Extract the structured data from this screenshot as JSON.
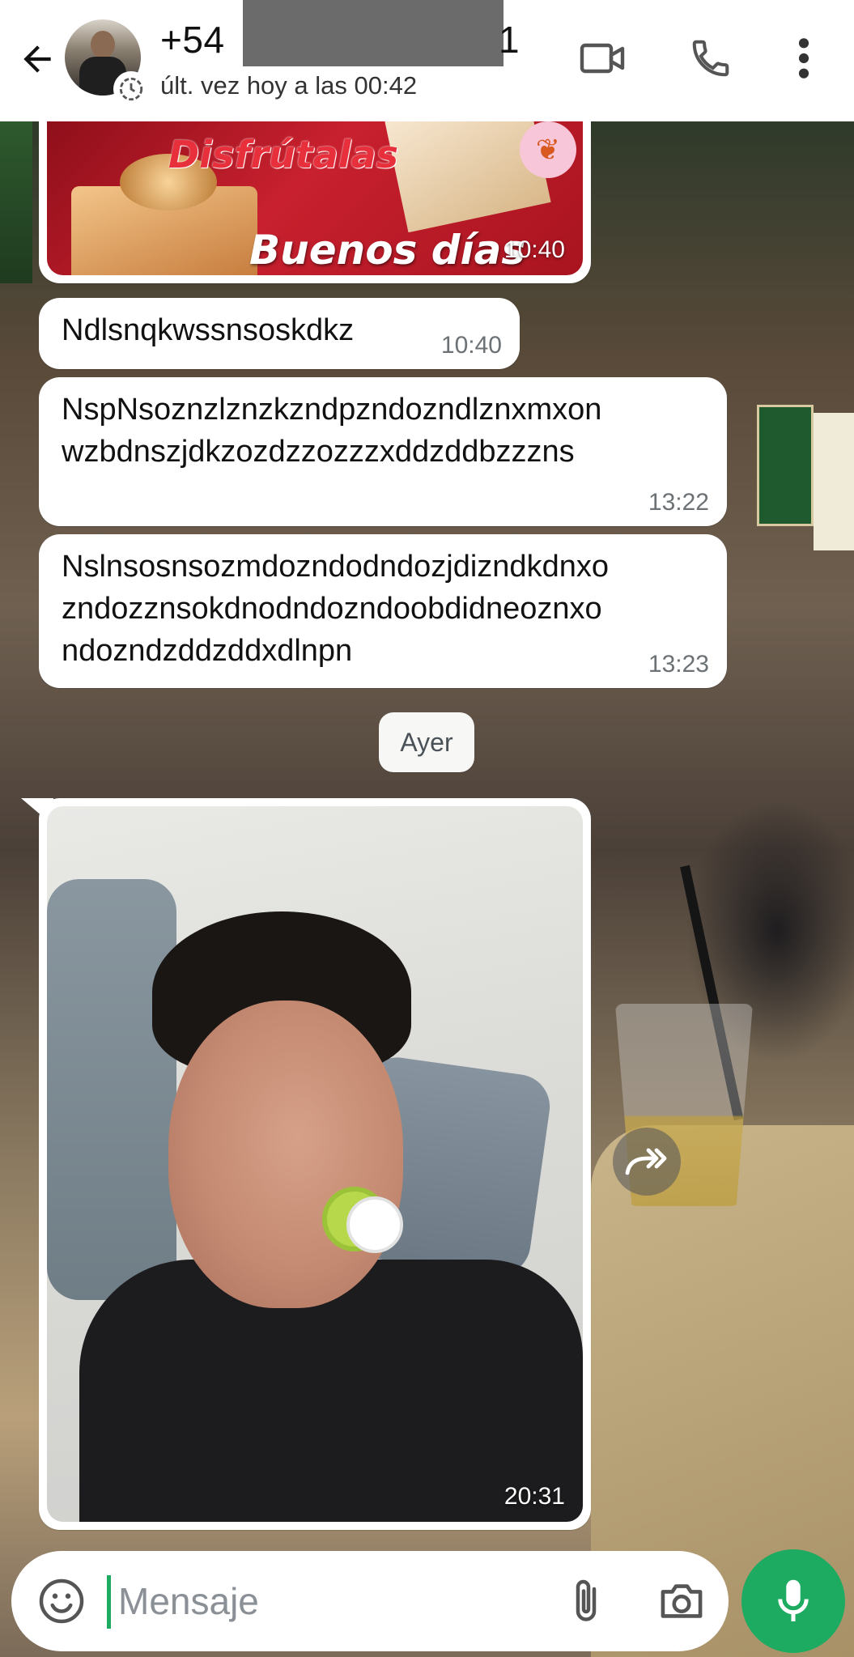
{
  "header": {
    "contact_name_prefix": "+54",
    "contact_name_suffix": "1",
    "last_seen": "últ. vez hoy a las 00:42",
    "icons": [
      "back-arrow-icon",
      "video-call-icon",
      "phone-icon",
      "more-options-icon"
    ]
  },
  "messages": [
    {
      "type": "image",
      "image_text_line1": "Disfrútalas",
      "image_text_line2": "Buenos días",
      "time": "10:40"
    },
    {
      "type": "text",
      "text": "Ndlsnqkwssnsoskdkz",
      "time": "10:40"
    },
    {
      "type": "text",
      "text": "NspNsoznzlznzkzndpzndozndlznxmxon\nwzbdnszjdkzozdzzozzzxddzddbzzzns",
      "time": "13:22"
    },
    {
      "type": "text",
      "text": "Nslnsosnsozmdozndodndozjdizndkdnxo\nzndozznsokdnodndozndoobdidneoznxo\nndozndzddzddxdlnpn",
      "time": "13:23"
    },
    {
      "type": "image",
      "time": "20:31"
    }
  ],
  "date_separator": "Ayer",
  "composer": {
    "placeholder": "Mensaje",
    "value": ""
  },
  "colors": {
    "accent": "#1daa61",
    "bubble": "#ffffff",
    "header_bg": "#ffffff"
  }
}
